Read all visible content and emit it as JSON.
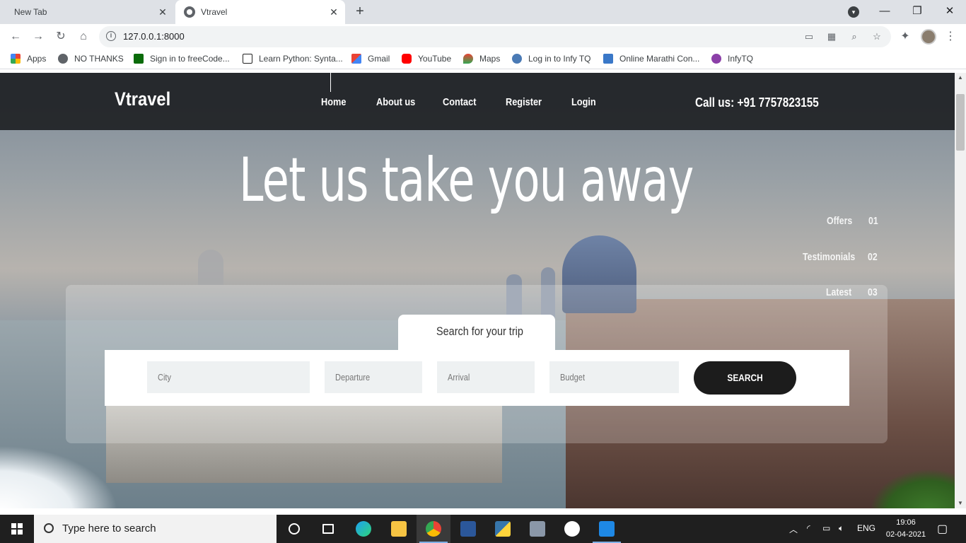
{
  "browser": {
    "tabs": [
      {
        "label": "New Tab"
      },
      {
        "label": "Vtravel"
      }
    ],
    "url": "127.0.0.1:8000",
    "bookmarks": [
      {
        "label": "Apps",
        "icon": "apps-grid-icon"
      },
      {
        "label": "NO THANKS",
        "icon": "globe-icon"
      },
      {
        "label": "Sign in to freeCode...",
        "icon": "freecodecamp-icon"
      },
      {
        "label": "Learn Python: Synta...",
        "icon": "codecademy-icon"
      },
      {
        "label": "Gmail",
        "icon": "gmail-icon"
      },
      {
        "label": "YouTube",
        "icon": "youtube-icon"
      },
      {
        "label": "Maps",
        "icon": "maps-icon"
      },
      {
        "label": "Log in to Infy TQ",
        "icon": "infytq-icon"
      },
      {
        "label": "Online Marathi Con...",
        "icon": "shield-icon"
      },
      {
        "label": "InfyTQ",
        "icon": "infytq-logo-icon"
      }
    ]
  },
  "site": {
    "logo": "Vtravel",
    "nav": [
      "Home",
      "About us",
      "Contact",
      "Register",
      "Login"
    ],
    "call": "Call us: +91 7757823155",
    "hero_title": "Let us take you away",
    "side_nav": [
      {
        "label": "Offers",
        "num": "01"
      },
      {
        "label": "Testimonials",
        "num": "02"
      },
      {
        "label": "Latest",
        "num": "03"
      }
    ],
    "search": {
      "tab_label": "Search for your trip",
      "city": "City",
      "departure": "Departure",
      "arrival": "Arrival",
      "budget": "Budget",
      "button": "SEARCH"
    }
  },
  "taskbar": {
    "search_placeholder": "Type here to search",
    "lang": "ENG",
    "time": "19:06",
    "date": "02-04-2021"
  }
}
